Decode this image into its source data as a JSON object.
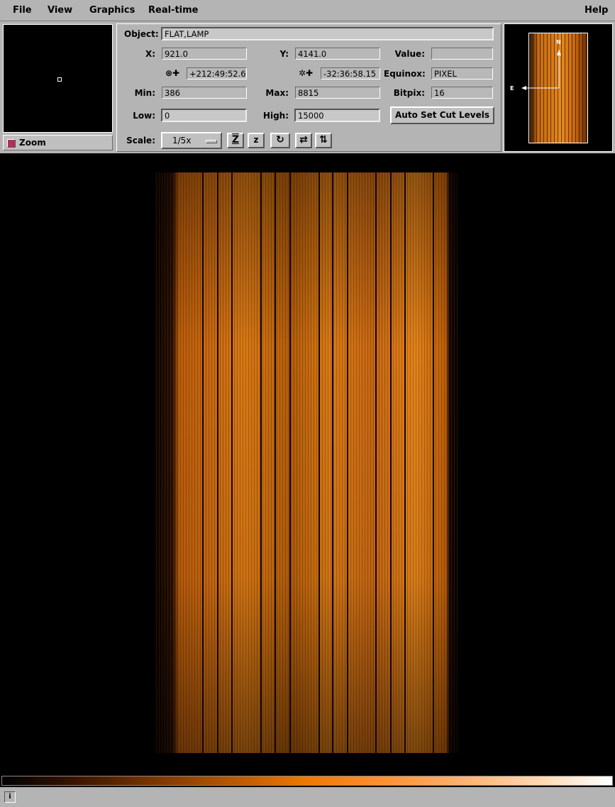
{
  "menu": {
    "file": "File",
    "view": "View",
    "graphics": "Graphics",
    "realtime": "Real-time",
    "help": "Help"
  },
  "zoom": {
    "toggle_label": "Zoom"
  },
  "info": {
    "object_label": "Object:",
    "object_value": "FLAT,LAMP",
    "x_label": "X:",
    "x_value": "921.0",
    "y_label": "Y:",
    "y_value": "4141.0",
    "value_label": "Value:",
    "value_value": "",
    "ra_value": "+212:49:52.63",
    "dec_value": "-32:36:58.15",
    "equinox_label": "Equinox:",
    "equinox_value": "PIXEL",
    "min_label": "Min:",
    "min_value": "386",
    "max_label": "Max:",
    "max_value": "8815",
    "bitpix_label": "Bitpix:",
    "bitpix_value": "16",
    "low_label": "Low:",
    "low_value": "0",
    "high_label": "High:",
    "high_value": "15000",
    "auto_cut_label": "Auto Set Cut Levels",
    "scale_label": "Scale:",
    "scale_value": "1/5x"
  },
  "toolbar_icons": [
    "zoom-fit-icon",
    "zoom-in-icon",
    "rotate-icon",
    "flip-x-icon",
    "flip-y-icon"
  ],
  "panner": {
    "north_label": "N",
    "east_label": "E"
  },
  "colors": {
    "panel": "#b4b4b4",
    "image_accent": "#e07a10",
    "background": "#000000"
  }
}
